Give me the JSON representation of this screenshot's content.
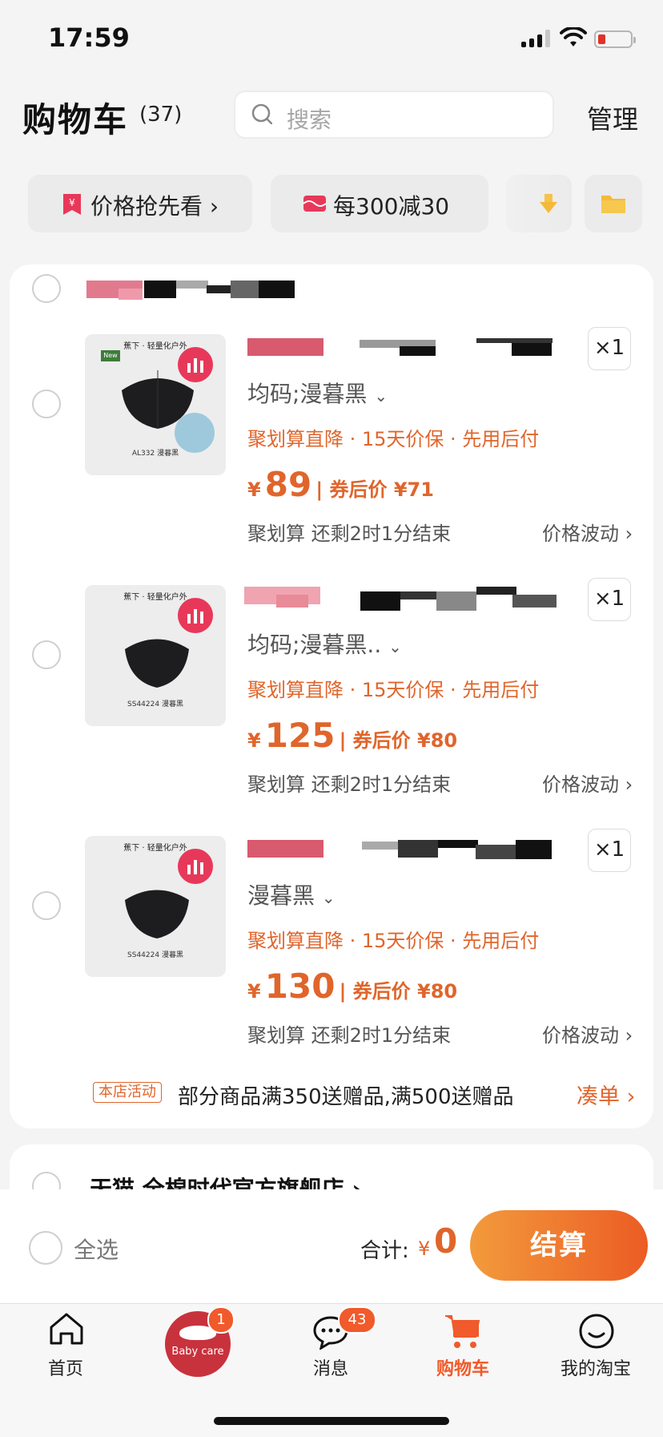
{
  "status_bar": {
    "time": "17:59"
  },
  "header": {
    "title": "购物车",
    "count": "(37)",
    "search_placeholder": "搜索",
    "manage": "管理"
  },
  "promo_chips": [
    {
      "label": "价格抢先看 ›"
    },
    {
      "label": "每300减30"
    }
  ],
  "cart": {
    "items": [
      {
        "variant": "均码;漫暮黑",
        "promo": "聚划算直降 · 15天价保 · 先用后付",
        "price": "89",
        "after_coupon": "| 券后价 ¥71",
        "countdown": "聚划算 还剩2时1分结束",
        "fluctuation": "价格波动 ›",
        "qty": "×1",
        "thumb_caption": "AL332 漫暮黑"
      },
      {
        "variant": "均码;漫暮黑..",
        "promo": "聚划算直降 · 15天价保 · 先用后付",
        "price": "125",
        "after_coupon": "| 券后价 ¥80",
        "countdown": "聚划算 还剩2时1分结束",
        "fluctuation": "价格波动 ›",
        "qty": "×1",
        "thumb_caption": "SS44224 漫暮黑"
      },
      {
        "variant": "漫暮黑",
        "promo": "聚划算直降 · 15天价保 · 先用后付",
        "price": "130",
        "after_coupon": "| 券后价 ¥80",
        "countdown": "聚划算 还剩2时1分结束",
        "fluctuation": "价格波动 ›",
        "qty": "×1",
        "thumb_caption": "SS44224 漫暮黑"
      }
    ],
    "thumb_brand": "蕉下 · 轻量化户外",
    "thumb_new": "New",
    "currency": "¥",
    "store_activity": {
      "tag": "本店活动",
      "text": "部分商品满350送赠品,满500送赠品",
      "cta": "凑单 ›"
    }
  },
  "next_store": {
    "title": "天猫 全棉时代官方旗舰店 ›"
  },
  "checkout": {
    "select_all": "全选",
    "total_label": "合计:",
    "total_currency": "¥",
    "total_value": "0",
    "button": "结算"
  },
  "tabbar": {
    "tabs": [
      {
        "label": "首页"
      },
      {
        "label": ""
      },
      {
        "label": "消息"
      },
      {
        "label": "购物车"
      },
      {
        "label": "我的淘宝"
      }
    ],
    "babycare_text": "Baby care",
    "babycare_badge": "1",
    "messages_badge": "43",
    "active_color": "#f15a2b"
  },
  "colors": {
    "accent": "#e0652b",
    "checkout_gradient_start": "#f29b3c",
    "checkout_gradient_end": "#ec5c24"
  }
}
